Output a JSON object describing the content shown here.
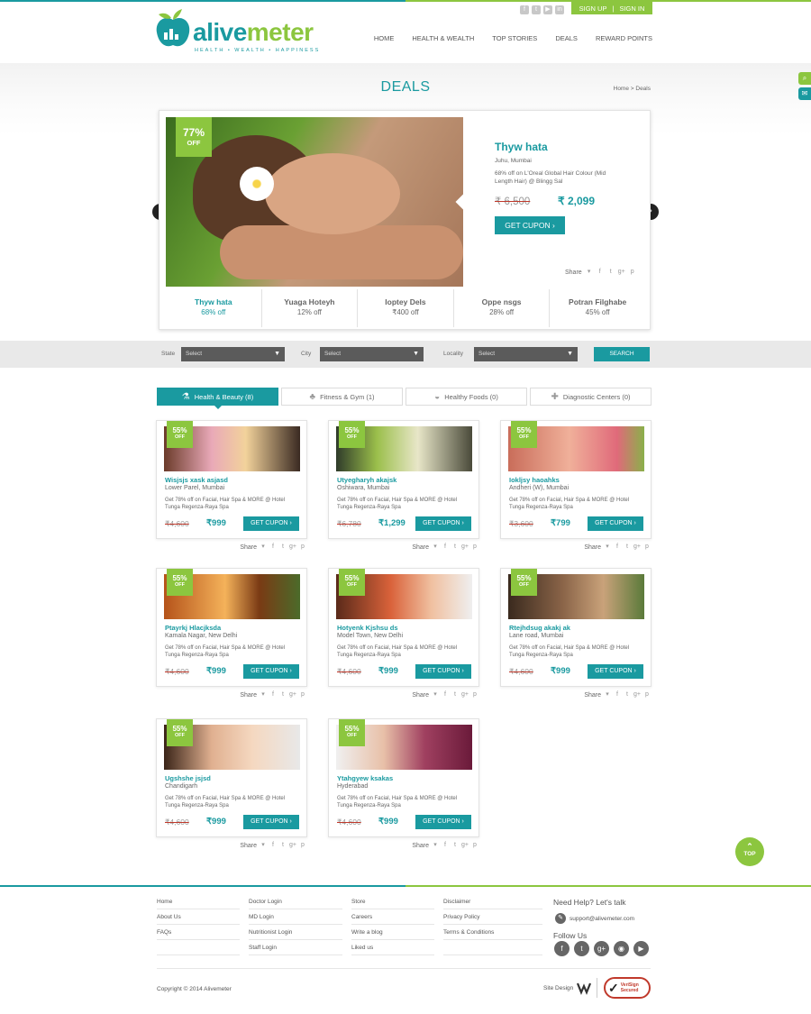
{
  "brand": {
    "name_part1": "alive",
    "name_part2": "meter",
    "tagline": "HEALTH  •  WEALTH  •  HAPPINESS"
  },
  "auth": {
    "signup": "SIGN UP",
    "separator": "|",
    "signin": "SIGN IN"
  },
  "nav": [
    "HOME",
    "HEALTH & WEALTH",
    "TOP STORIES",
    "DEALS",
    "REWARD POINTS"
  ],
  "page": {
    "title": "DEALS",
    "breadcrumb": "Home > Deals"
  },
  "featured": {
    "off_percent": "77%",
    "off_label": "OFF",
    "title": "Thyw hata",
    "location": "Juhu, Mumbai",
    "description": "68% off on L'Oreal Global Hair Colour (Mid Length Hair) @ Blingg Sal",
    "old_price": "₹ 6,500",
    "new_price": "₹ 2,099",
    "button": "GET CUPON",
    "share_label": "Share"
  },
  "slider_tabs": [
    {
      "name": "Thyw hata",
      "off": "68% off"
    },
    {
      "name": "Yuaga Hoteyh",
      "off": "12% off"
    },
    {
      "name": "Ioptey Dels",
      "off": "₹400 off"
    },
    {
      "name": "Oppe nsgs",
      "off": "28% off"
    },
    {
      "name": "Potran Filghabe",
      "off": "45% off"
    }
  ],
  "filter": {
    "state_label": "State",
    "city_label": "City",
    "locality_label": "Locality",
    "placeholder": "Select",
    "search": "SEARCH"
  },
  "categories": [
    {
      "label": "Health & Beauty (8)",
      "icon": "⚗"
    },
    {
      "label": "Fitness & Gym (1)",
      "icon": "♣"
    },
    {
      "label": "Healthy Foods (0)",
      "icon": "◒"
    },
    {
      "label": "Diagnostic Centers (0)",
      "icon": "✚"
    }
  ],
  "deals": [
    {
      "off": "55%",
      "off_label": "OFF",
      "title": "Wisjsjs xask asjasd",
      "location": "Lower Parel, Mumbai",
      "desc": "Get 78% off on Facial, Hair Spa & MORE @ Hotel Tunga Regenza-Raya Spa",
      "old": "₹4,600",
      "new": "₹999",
      "button": "GET CUPON",
      "share": "Share",
      "img_bg": "linear-gradient(90deg,#6b3b2a,#e9a9b8 35%,#f2d29b 60%,#3a2a22)"
    },
    {
      "off": "55%",
      "off_label": "OFF",
      "title": "Utyegharyh akajsk",
      "location": "Oshiwara, Mumbai",
      "desc": "Get 78% off on Facial, Hair Spa & MORE @ Hotel Tunga Regenza-Raya Spa",
      "old": "₹6,780",
      "new": "₹1,299",
      "button": "GET CUPON",
      "share": "Share",
      "img_bg": "linear-gradient(90deg,#2f3b2a,#9bbf4b 30%,#e8e6c8 60%,#4a4a3a)"
    },
    {
      "off": "55%",
      "off_label": "OFF",
      "title": "Iokljsy haoahks",
      "location": "Andheri (W), Mumbai",
      "desc": "Get 78% off on Facial, Hair Spa & MORE @ Hotel Tunga Regenza-Raya Spa",
      "old": "₹3,600",
      "new": "₹799",
      "button": "GET CUPON",
      "share": "Share",
      "img_bg": "linear-gradient(90deg,#c96d5a,#f0b09a 45%,#e06a7a 80%,#8ab04a)"
    },
    {
      "off": "55%",
      "off_label": "OFF",
      "title": "Ptayrkj Hlacjksda",
      "location": "Kamala Nagar, New Delhi",
      "desc": "Get 78% off on Facial, Hair Spa & MORE @ Hotel Tunga Regenza-Raya Spa",
      "old": "₹4,600",
      "new": "₹999",
      "button": "GET CUPON",
      "share": "Share",
      "img_bg": "linear-gradient(90deg,#b5531a,#f4b25a 45%,#7a3a14 70%,#4b6b2a)"
    },
    {
      "off": "55%",
      "off_label": "OFF",
      "title": "Hotyenk Kjshsu ds",
      "location": "Model Town, New Delhi",
      "desc": "Get 78% off on Facial, Hair Spa & MORE @ Hotel Tunga Regenza-Raya Spa",
      "old": "₹4,600",
      "new": "₹999",
      "button": "GET CUPON",
      "share": "Share",
      "img_bg": "linear-gradient(90deg,#5a2a1a,#d9623a 40%,#f0c0a0 70%,#efefef)"
    },
    {
      "off": "55%",
      "off_label": "OFF",
      "title": "Rtejhdsug akakj ak",
      "location": "Lane road, Mumbai",
      "desc": "Get 78% off on Facial, Hair Spa & MORE @ Hotel Tunga Regenza-Raya Spa",
      "old": "₹4,600",
      "new": "₹999",
      "button": "GET CUPON",
      "share": "Share",
      "img_bg": "linear-gradient(90deg,#3a2a1e,#8a6448 40%,#c9a27a 70%,#5a7a3a)"
    },
    {
      "off": "55%",
      "off_label": "OFF",
      "title": "Ugshshe jsjsd",
      "location": "Chandigarh",
      "desc": "Get 78% off on Facial, Hair Spa & MORE @ Hotel Tunga Regenza-Raya Spa",
      "old": "₹4,600",
      "new": "₹999",
      "button": "GET CUPON",
      "share": "Share",
      "img_bg": "linear-gradient(90deg,#3a2418,#e0b090 35%,#f5d8c0 65%,#e8e8e8)"
    },
    {
      "off": "55%",
      "off_label": "OFF",
      "title": "Ytahgyew ksakas",
      "location": "Hyderabad",
      "desc": "Get 78% off on Facial, Hair Spa & MORE @ Hotel Tunga Regenza-Raya Spa",
      "old": "₹4,600",
      "new": "₹999",
      "button": "GET CUPON",
      "share": "Share",
      "img_bg": "linear-gradient(90deg,#f0f0f0,#e8c0a8 35%,#a04060 65%,#6a1a3a)"
    }
  ],
  "top_button": "TOP",
  "footer": {
    "col1": [
      "Home",
      "About Us",
      "FAQs"
    ],
    "col2": [
      "Doctor Login",
      "MD Login",
      "Nutritionist Login",
      "Staff Login"
    ],
    "col3": [
      "Store",
      "Careers",
      "Write a blog",
      "Liked us"
    ],
    "col4": [
      "Disclaimer",
      "Privacy Policy",
      "Terms & Conditions"
    ],
    "help": "Need Help? Let's talk",
    "email": "support@alivemeter.com",
    "follow": "Follow Us",
    "copyright": "Copyright © 2014 Alivemeter",
    "site_design": "Site Design",
    "verisign_1": "VeriSign",
    "verisign_2": "Secured"
  },
  "colors": {
    "teal": "#1a9aa0",
    "green": "#8cc63f",
    "strike_red": "#c0392b"
  }
}
